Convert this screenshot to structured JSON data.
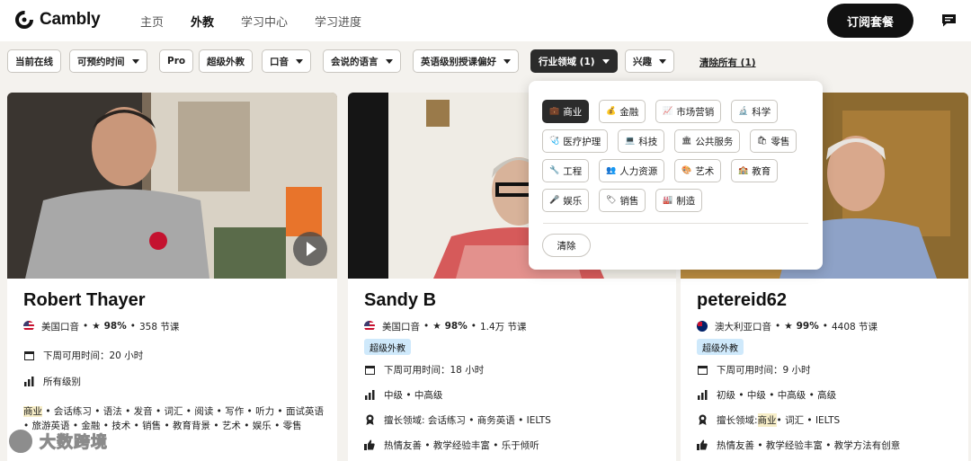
{
  "brand": "Cambly",
  "nav": {
    "items": [
      {
        "label": "主页",
        "active": false
      },
      {
        "label": "外教",
        "active": true
      },
      {
        "label": "学习中心",
        "active": false
      },
      {
        "label": "学习进度",
        "active": false
      }
    ],
    "subscribe_label": "订阅套餐",
    "message_icon": "chat-icon"
  },
  "filters": {
    "chips": [
      {
        "label": "当前在线",
        "dropdown": false
      },
      {
        "label": "可预约时间",
        "dropdown": true
      },
      {
        "label": "Pro",
        "dropdown": false
      },
      {
        "label": "超级外教",
        "dropdown": false
      },
      {
        "label": "口音",
        "dropdown": true
      },
      {
        "label": "会说的语言",
        "dropdown": true
      },
      {
        "label": "英语级别授课偏好",
        "dropdown": true
      },
      {
        "label": "行业领域 (1)",
        "dropdown": true,
        "active": true
      },
      {
        "label": "兴趣",
        "dropdown": true
      }
    ],
    "clear_all": "清除所有 (1)"
  },
  "industry_dropdown": {
    "options": [
      {
        "emoji": "💼",
        "label": "商业",
        "selected": true
      },
      {
        "emoji": "💰",
        "label": "金融",
        "selected": false
      },
      {
        "emoji": "📈",
        "label": "市场营销",
        "selected": false
      },
      {
        "emoji": "🔬",
        "label": "科学",
        "selected": false
      },
      {
        "emoji": "🩺",
        "label": "医疗护理",
        "selected": false
      },
      {
        "emoji": "💻",
        "label": "科技",
        "selected": false
      },
      {
        "emoji": "🏛",
        "label": "公共服务",
        "selected": false
      },
      {
        "emoji": "🛍",
        "label": "零售",
        "selected": false
      },
      {
        "emoji": "🔧",
        "label": "工程",
        "selected": false
      },
      {
        "emoji": "👥",
        "label": "人力资源",
        "selected": false
      },
      {
        "emoji": "🎨",
        "label": "艺术",
        "selected": false
      },
      {
        "emoji": "🏫",
        "label": "教育",
        "selected": false
      },
      {
        "emoji": "🎤",
        "label": "娱乐",
        "selected": false
      },
      {
        "emoji": "🏷",
        "label": "销售",
        "selected": false
      },
      {
        "emoji": "🏭",
        "label": "制造",
        "selected": false
      }
    ],
    "clear_label": "清除"
  },
  "tutors": [
    {
      "name": "Robert Thayer",
      "accent": "美国口音",
      "rating": "98%",
      "lessons": "358 节课",
      "super_tutor": false,
      "availability": "下周可用时间：20 小时",
      "levels": "所有级别",
      "tags_highlight": "商业",
      "tags_rest": " • 会话练习 • 语法 • 发音 • 词汇 • 阅读 • 写作 • 听力 • 面试英语 • 旅游英语 • 金融 • 技术 • 销售 • 教育背景 • 艺术 • 娱乐 • 零售"
    },
    {
      "name": "Sandy B",
      "accent": "美国口音",
      "rating": "98%",
      "lessons": "1.4万 节课",
      "super_tutor": true,
      "super_label": "超级外教",
      "availability": "下周可用时间：18 小时",
      "levels": "中级 • 中高级",
      "specialty": "擅长领域: 会话练习 • 商务英语 • IELTS",
      "traits": "热情友善 • 教学经验丰富 • 乐于倾听"
    },
    {
      "name": "petereid62",
      "accent": "澳大利亚口音",
      "rating": "99%",
      "lessons": "4408 节课",
      "super_tutor": true,
      "super_label": "超级外教",
      "availability": "下周可用时间：9 小时",
      "levels": "初级 • 中级 • 中高级 • 高级",
      "specialty_prefix": "擅长领域: ",
      "specialty_highlight": "商业",
      "specialty_rest": " • 词汇 • IELTS",
      "traits": "热情友善 • 教学经验丰富 • 教学方法有创意"
    }
  ],
  "watermark": "大数跨境",
  "colors": {
    "accent_dark": "#111111",
    "badge_blue": "#cfe9fb",
    "highlight": "#f7eec8"
  }
}
